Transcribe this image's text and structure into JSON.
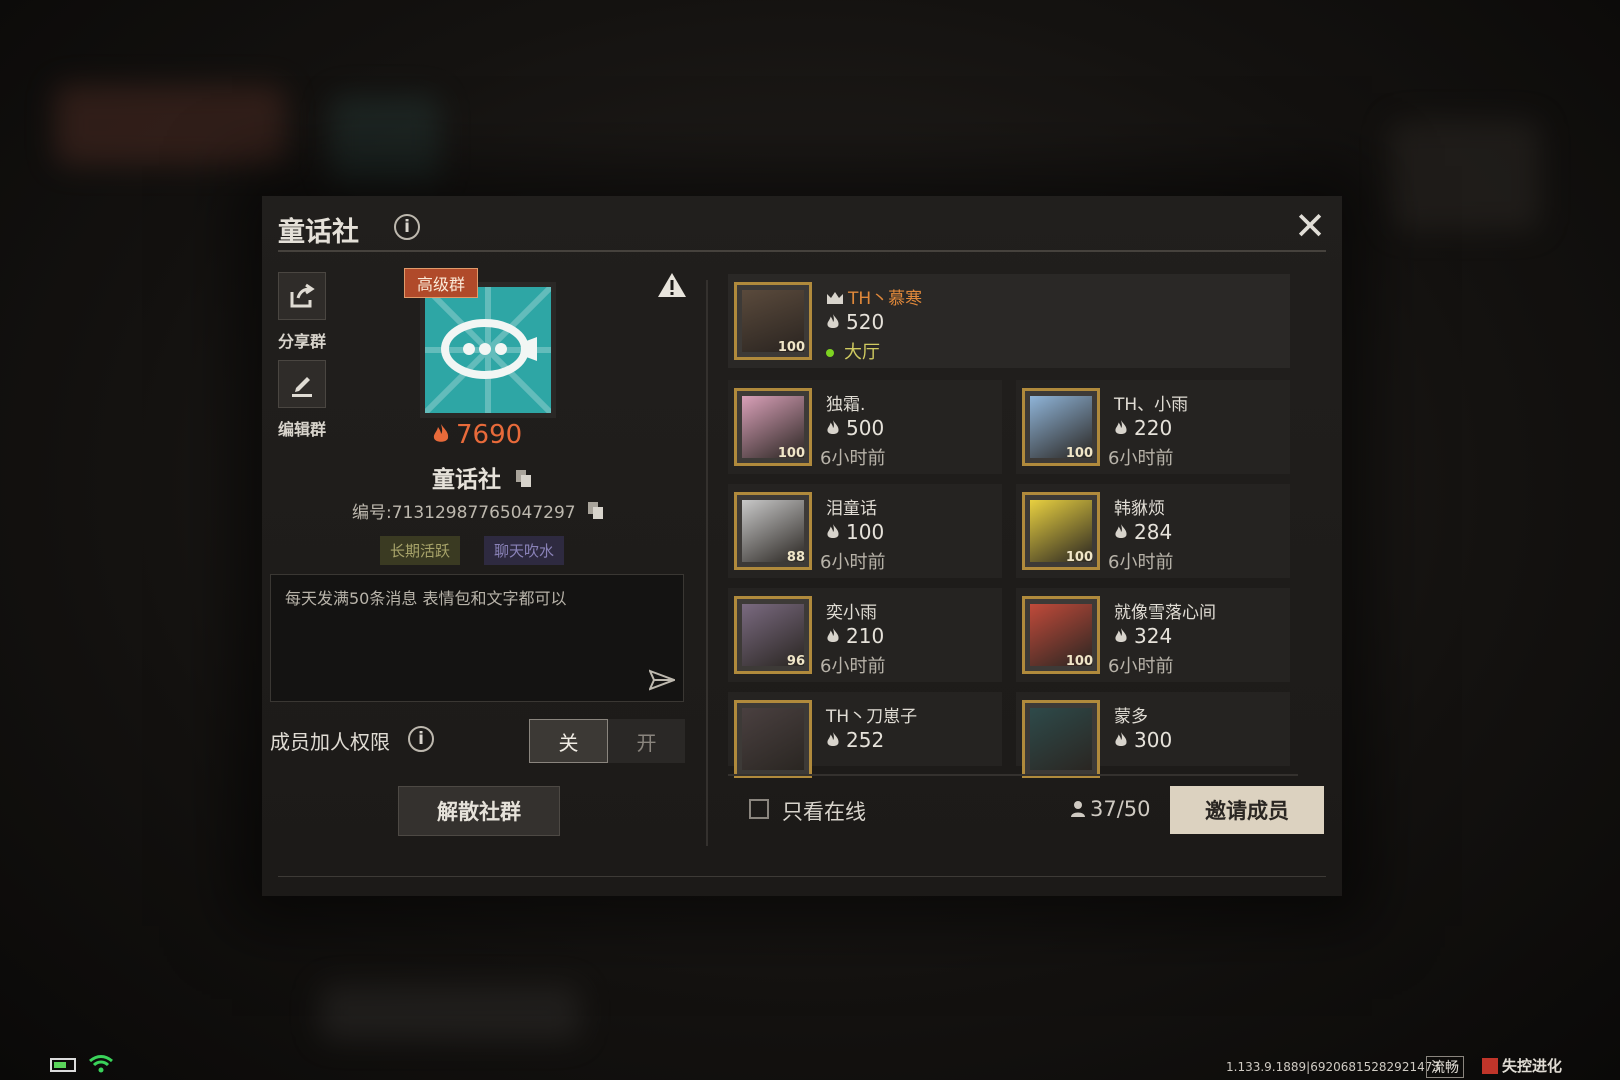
{
  "dialog": {
    "title": "童话社",
    "close_icon": "close-icon"
  },
  "side": {
    "share_label": "分享群",
    "edit_label": "编辑群"
  },
  "group": {
    "badge": "高级群",
    "heat": "7690",
    "name": "童话社",
    "id_text": "编号:71312987765047297",
    "tags": [
      "长期活跃",
      "聊天吹水"
    ],
    "notice": "每天发满50条消息 表情包和文字都可以"
  },
  "permission": {
    "label": "成员加人权限",
    "off_label": "关",
    "on_label": "开",
    "selected": "关"
  },
  "dissolve_label": "解散社群",
  "owner": {
    "name": "TH丶慕寒",
    "heat": "520",
    "location": "大厅",
    "level": "100"
  },
  "members": [
    {
      "name": "独霜.",
      "heat": "500",
      "time": "6小时前",
      "level": "100"
    },
    {
      "name": "TH、小雨",
      "heat": "220",
      "time": "6小时前",
      "level": "100"
    },
    {
      "name": "泪童话",
      "heat": "100",
      "time": "6小时前",
      "level": "88"
    },
    {
      "name": "韩貅烦",
      "heat": "284",
      "time": "6小时前",
      "level": "100"
    },
    {
      "name": "奕小雨",
      "heat": "210",
      "time": "6小时前",
      "level": "96"
    },
    {
      "name": "就像雪落心间",
      "heat": "324",
      "time": "6小时前",
      "level": "100"
    },
    {
      "name": "TH丶刀崽子",
      "heat": "252",
      "time": "",
      "level": ""
    },
    {
      "name": "蒙多",
      "heat": "300",
      "time": "",
      "level": ""
    }
  ],
  "footer": {
    "online_only_label": "只看在线",
    "count": "37/50",
    "invite_label": "邀请成员"
  },
  "statusbar": {
    "version": "1.133.9.1889|69206815282921473",
    "quality": "流畅",
    "logo_text": "失控进化"
  },
  "colors": {
    "accent_heat": "#e86a3a",
    "owner_name": "#e0883a",
    "online_dot": "#7ed321",
    "invite_bg": "#dcd2c0"
  }
}
